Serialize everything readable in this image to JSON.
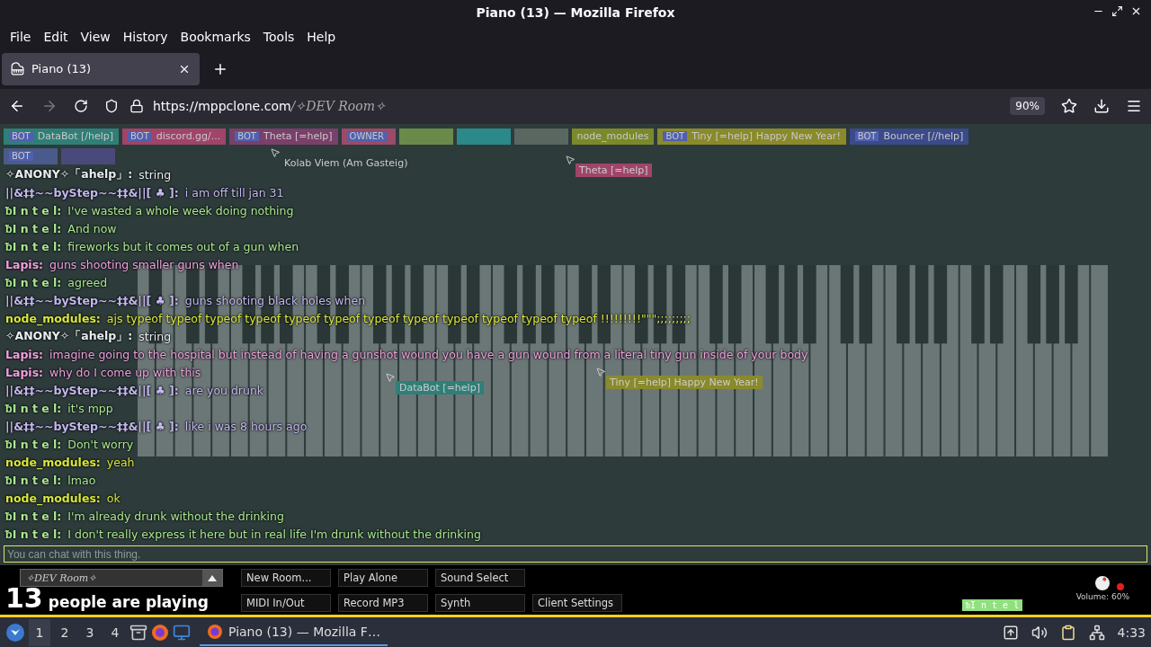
{
  "window": {
    "title": "Piano (13) — Mozilla Firefox"
  },
  "menu": [
    "File",
    "Edit",
    "View",
    "History",
    "Bookmarks",
    "Tools",
    "Help"
  ],
  "tabs": [
    {
      "label": "Piano (13)",
      "selected": true
    }
  ],
  "address_bar": {
    "host": "https://mppclone.com",
    "path": "/✧DEV Room✧",
    "zoom": "90%"
  },
  "user_tags": [
    {
      "badge": "BOT",
      "name": "DataBot [/help]",
      "color": "#2f7f78"
    },
    {
      "badge": "BOT",
      "name": "discord.gg/...",
      "color": "#a0446a"
    },
    {
      "badge": "BOT",
      "name": "Theta [=help]",
      "color": "#7a3f6a"
    },
    {
      "badge": "OWNER",
      "color": "#9a4a6a"
    },
    {
      "color": "#6a8a4a"
    },
    {
      "color": "#2a8a8a"
    },
    {
      "color": "#5a6660"
    },
    {
      "name": "node_modules",
      "color": "#7a8a2a"
    },
    {
      "badge": "BOT",
      "name": "Tiny [=help] Happy New Year!",
      "color": "#8a8a2a"
    },
    {
      "badge": "BOT",
      "name": "Bouncer [//help]",
      "color": "#3a4a8a"
    },
    {
      "badge": "BOT",
      "color": "#4a5a8a"
    },
    {
      "color": "#4a4a7a"
    }
  ],
  "cursor_labels": [
    {
      "name": "Kolab Viem (Am Gasteig)",
      "color": "#2d3a3a"
    },
    {
      "name": "Theta [=help]",
      "color": "#a0446a"
    },
    {
      "name": "DataBot [=help]",
      "color": "#2f7f78"
    },
    {
      "name": "Tiny [=help] Happy New Year!",
      "color": "#8a8a2a"
    }
  ],
  "chat": [
    {
      "user": "✧ANONY✧「ahelp」:",
      "text": "string",
      "color": "#e8eef0"
    },
    {
      "user": "||&‡‡~~byStep~~‡‡&||[ ♣ ]:",
      "text": "i am off till jan 31",
      "color": "#c4b8f0"
    },
    {
      "user": "ᵬI n t e l:",
      "text": "I've wasted a whole week doing nothing",
      "color": "#a8e890"
    },
    {
      "user": "ᵬI n t e l:",
      "text": "And now",
      "color": "#a8e890"
    },
    {
      "user": "ᵬI n t e l:",
      "text": "fireworks but it comes out of a gun when",
      "color": "#a8e890"
    },
    {
      "user": "Lapis:",
      "text": "guns shooting smaller guns when",
      "color": "#f0a0e0"
    },
    {
      "user": "ᵬI n t e l:",
      "text": "agreed",
      "color": "#a8e890"
    },
    {
      "user": "||&‡‡~~byStep~~‡‡&||[ ♣ ]:",
      "text": "guns shooting black holes when",
      "color": "#c4b8f0"
    },
    {
      "user": "node_modules:",
      "text": "ajs typeof typeof typeof typeof typeof typeof typeof typeof typeof typeof typeof typeof !!!!!!!!!\"\"\";;;;;;;;;",
      "color": "#d8e83a"
    },
    {
      "user": "✧ANONY✧「ahelp」:",
      "text": "string",
      "color": "#e8eef0"
    },
    {
      "user": "Lapis:",
      "text": "imagine going to the hospital but instead of having a gunshot wound you have a gun wound from a literal tiny gun inside of your body",
      "color": "#f0a0e0"
    },
    {
      "user": "Lapis:",
      "text": "why do I come up with this",
      "color": "#f0a0e0"
    },
    {
      "user": "||&‡‡~~byStep~~‡‡&||[ ♣ ]:",
      "text": "are you drunk",
      "color": "#c4b8f0"
    },
    {
      "user": "ᵬI n t e l:",
      "text": "it's mpp",
      "color": "#a8e890"
    },
    {
      "user": "||&‡‡~~byStep~~‡‡&||[ ♣ ]:",
      "text": "like i was 8 hours ago",
      "color": "#c4b8f0"
    },
    {
      "user": "ᵬI n t e l:",
      "text": "Don't worry",
      "color": "#a8e890"
    },
    {
      "user": "node_modules:",
      "text": "yeah",
      "color": "#d8e83a"
    },
    {
      "user": "ᵬI n t e l:",
      "text": "lmao",
      "color": "#a8e890"
    },
    {
      "user": "node_modules:",
      "text": "ok",
      "color": "#d8e83a"
    },
    {
      "user": "ᵬI n t e l:",
      "text": "I'm already drunk without the drinking",
      "color": "#a8e890"
    },
    {
      "user": "ᵬI n t e l:",
      "text": "I don't really express it here but in real life I'm drunk without the drinking",
      "color": "#a8e890"
    }
  ],
  "chat_input": {
    "placeholder": "You can chat with this thing."
  },
  "room": {
    "name": "✧DEV Room✧"
  },
  "player_count": {
    "count": "13",
    "label": "people are playing"
  },
  "buttons": [
    [
      "New Room...",
      "Play Alone",
      "Sound Select"
    ],
    [
      "MIDI In/Out",
      "Record MP3",
      "Synth",
      "Client Settings"
    ]
  ],
  "volume": {
    "label": "Volume: 60%"
  },
  "own_tag": {
    "name": "ᵬI n t e l"
  },
  "taskbar": {
    "workspaces": [
      {
        "label": "1",
        "selected": true
      },
      {
        "label": "2",
        "selected": false
      },
      {
        "label": "3",
        "selected": false
      },
      {
        "label": "4",
        "selected": false
      }
    ],
    "task": "Piano (13) — Mozilla F…",
    "clock": "4:33"
  }
}
